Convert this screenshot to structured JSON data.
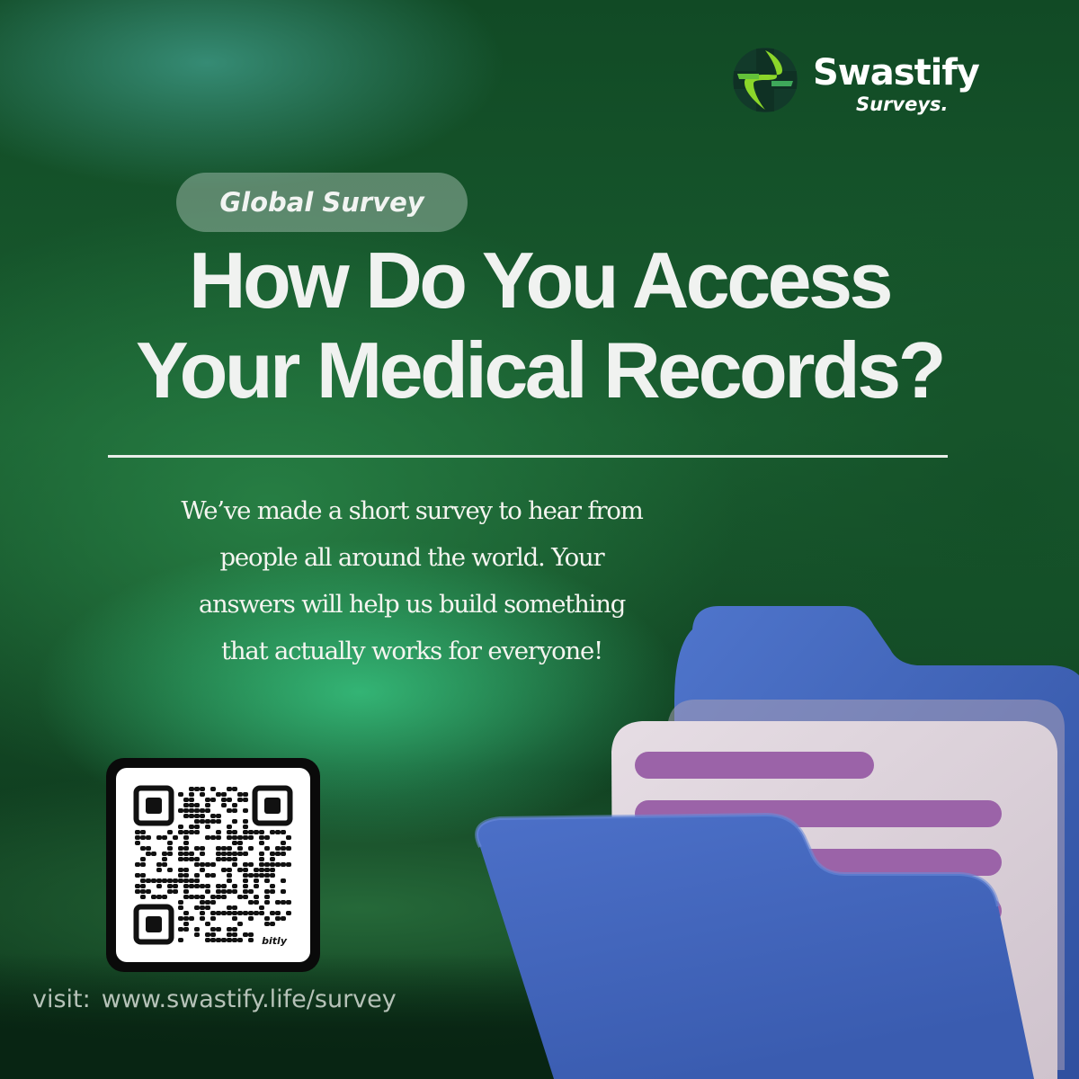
{
  "brand": {
    "name": "Swastify",
    "subtitle": "Surveys.",
    "icon": "plus-cross-logo"
  },
  "badge": {
    "label": "Global Survey"
  },
  "headline": {
    "line1": "How Do You Access",
    "line2": "Your Medical Records?"
  },
  "body": {
    "line1": "We’ve made a short survey to hear from",
    "line2": "people all around the world. Your",
    "line3": "answers will help us build something",
    "line4": "that actually works for everyone!"
  },
  "qr": {
    "brand": "bitly"
  },
  "visit": {
    "label": "visit:",
    "url": "www.swastify.life/survey"
  },
  "illustration": {
    "icon": "open-folder-with-documents-icon"
  },
  "colors": {
    "background": "#195c2f",
    "accent_glow": "#3cd28c",
    "logo_green": "#7ed321",
    "logo_dark": "#0f5a3a",
    "folder_blue": "#3f63b8",
    "document": "#ddd2da",
    "document_lines": "#9b63a8",
    "text": "#f0f2f0"
  }
}
